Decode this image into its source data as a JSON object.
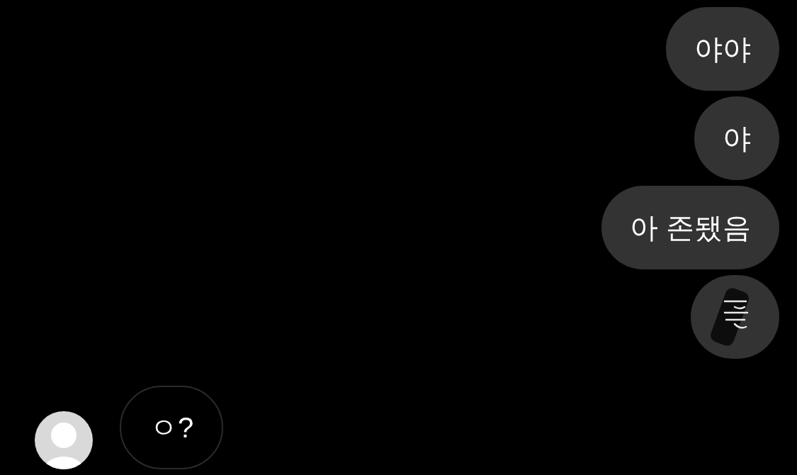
{
  "messages": [
    {
      "kind": "outgoing",
      "text": "야야"
    },
    {
      "kind": "outgoing",
      "text": "야"
    },
    {
      "kind": "outgoing",
      "text": "아 존됐음"
    },
    {
      "kind": "redacted"
    },
    {
      "kind": "incoming",
      "text": "ㅇ?"
    }
  ]
}
